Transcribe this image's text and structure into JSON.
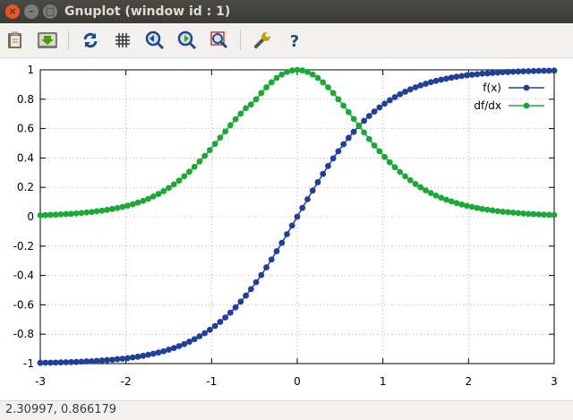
{
  "window": {
    "title": "Gnuplot (window id : 1)",
    "close_glyph": "×",
    "min_glyph": "–",
    "max_glyph": "□"
  },
  "toolbar": {
    "buttons": [
      {
        "name": "copy-clipboard-icon"
      },
      {
        "name": "export-icon"
      },
      {
        "name": "replot-icon"
      },
      {
        "name": "grid-icon"
      },
      {
        "name": "zoom-back-icon"
      },
      {
        "name": "zoom-forward-icon"
      },
      {
        "name": "autoscale-icon"
      },
      {
        "name": "settings-wrench-icon"
      },
      {
        "name": "help-icon"
      }
    ]
  },
  "status": {
    "coordinates": "2.30997,  0.866179"
  },
  "chart_data": {
    "type": "line",
    "title": "",
    "xlabel": "",
    "ylabel": "",
    "xlim": [
      -3,
      3
    ],
    "ylim": [
      -1,
      1
    ],
    "xticks": [
      "-3",
      "-2",
      "-1",
      "0",
      "1",
      "2",
      "3"
    ],
    "yticks": [
      "-1",
      "-0.8",
      "-0.6",
      "-0.4",
      "-0.2",
      "0",
      "0.2",
      "0.4",
      "0.6",
      "0.8",
      "1"
    ],
    "grid": true,
    "legend_position": "top-right",
    "x": [
      -3.0,
      -2.94,
      -2.88,
      -2.82,
      -2.76,
      -2.7,
      -2.64,
      -2.58,
      -2.52,
      -2.46,
      -2.4,
      -2.34,
      -2.28,
      -2.22,
      -2.16,
      -2.1,
      -2.04,
      -1.98,
      -1.92,
      -1.86,
      -1.8,
      -1.74,
      -1.68,
      -1.62,
      -1.56,
      -1.5,
      -1.44,
      -1.38,
      -1.32,
      -1.26,
      -1.2,
      -1.14,
      -1.08,
      -1.02,
      -0.96,
      -0.9,
      -0.84,
      -0.78,
      -0.72,
      -0.66,
      -0.6,
      -0.54,
      -0.48,
      -0.42,
      -0.36,
      -0.3,
      -0.24,
      -0.18,
      -0.12,
      -0.06,
      0.0,
      0.06,
      0.12,
      0.18,
      0.24,
      0.3,
      0.36,
      0.42,
      0.48,
      0.54,
      0.6,
      0.66,
      0.72,
      0.78,
      0.84,
      0.9,
      0.96,
      1.02,
      1.08,
      1.14,
      1.2,
      1.26,
      1.32,
      1.38,
      1.44,
      1.5,
      1.56,
      1.62,
      1.68,
      1.74,
      1.8,
      1.86,
      1.92,
      1.98,
      2.04,
      2.1,
      2.16,
      2.22,
      2.28,
      2.34,
      2.4,
      2.46,
      2.52,
      2.58,
      2.64,
      2.7,
      2.76,
      2.82,
      2.88,
      2.94,
      3.0
    ],
    "series": [
      {
        "name": "f(x)",
        "color": "#1f3f9a",
        "values": [
          -0.995,
          -0.994,
          -0.994,
          -0.993,
          -0.992,
          -0.991,
          -0.99,
          -0.989,
          -0.987,
          -0.985,
          -0.984,
          -0.981,
          -0.979,
          -0.976,
          -0.974,
          -0.97,
          -0.967,
          -0.963,
          -0.958,
          -0.953,
          -0.947,
          -0.94,
          -0.933,
          -0.925,
          -0.916,
          -0.905,
          -0.894,
          -0.881,
          -0.867,
          -0.851,
          -0.834,
          -0.814,
          -0.793,
          -0.77,
          -0.744,
          -0.716,
          -0.686,
          -0.653,
          -0.617,
          -0.578,
          -0.537,
          -0.493,
          -0.446,
          -0.397,
          -0.345,
          -0.291,
          -0.235,
          -0.178,
          -0.119,
          -0.06,
          0.0,
          0.06,
          0.119,
          0.178,
          0.235,
          0.291,
          0.345,
          0.397,
          0.446,
          0.493,
          0.537,
          0.578,
          0.617,
          0.653,
          0.686,
          0.716,
          0.744,
          0.77,
          0.793,
          0.814,
          0.834,
          0.851,
          0.867,
          0.881,
          0.894,
          0.905,
          0.916,
          0.925,
          0.933,
          0.94,
          0.947,
          0.953,
          0.958,
          0.963,
          0.967,
          0.97,
          0.974,
          0.976,
          0.979,
          0.981,
          0.984,
          0.985,
          0.987,
          0.989,
          0.99,
          0.991,
          0.992,
          0.993,
          0.994,
          0.994,
          0.995
        ]
      },
      {
        "name": "df/dx",
        "color": "#1ca836",
        "values": [
          0.01,
          0.011,
          0.013,
          0.014,
          0.016,
          0.018,
          0.02,
          0.023,
          0.025,
          0.029,
          0.032,
          0.037,
          0.041,
          0.047,
          0.053,
          0.059,
          0.067,
          0.075,
          0.085,
          0.096,
          0.108,
          0.122,
          0.138,
          0.155,
          0.174,
          0.196,
          0.22,
          0.246,
          0.275,
          0.306,
          0.34,
          0.376,
          0.414,
          0.454,
          0.496,
          0.538,
          0.581,
          0.623,
          0.664,
          0.702,
          0.739,
          0.764,
          0.8,
          0.842,
          0.881,
          0.915,
          0.945,
          0.968,
          0.986,
          0.996,
          1.0,
          0.996,
          0.986,
          0.968,
          0.945,
          0.915,
          0.881,
          0.842,
          0.8,
          0.757,
          0.712,
          0.666,
          0.62,
          0.574,
          0.529,
          0.485,
          0.446,
          0.407,
          0.371,
          0.337,
          0.305,
          0.275,
          0.248,
          0.223,
          0.2,
          0.179,
          0.161,
          0.144,
          0.129,
          0.116,
          0.104,
          0.093,
          0.083,
          0.074,
          0.067,
          0.06,
          0.053,
          0.048,
          0.043,
          0.038,
          0.034,
          0.031,
          0.028,
          0.025,
          0.022,
          0.02,
          0.018,
          0.016,
          0.014,
          0.013,
          0.012
        ]
      }
    ]
  }
}
